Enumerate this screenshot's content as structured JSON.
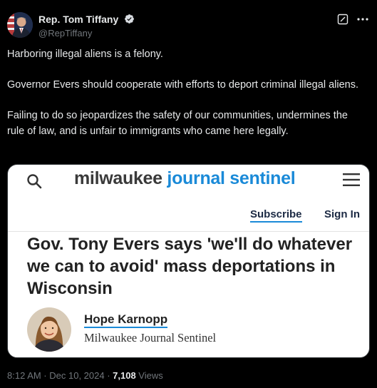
{
  "header": {
    "display_name": "Rep. Tom Tiffany",
    "handle": "@RepTiffany",
    "verified_icon": "verified-badge-icon",
    "grok_icon": "grok-icon",
    "more_icon": "more-icon"
  },
  "tweet": {
    "paragraphs": [
      "Harboring illegal aliens is a felony.",
      "Governor Evers should cooperate with efforts to deport criminal illegal aliens.",
      "Failing to do so jeopardizes the safety of our communities, undermines the rule of law, and is unfair to immigrants who came here legally."
    ]
  },
  "card": {
    "brand_word1": "milwaukee",
    "brand_word2": "journal sentinel",
    "subscribe": "Subscribe",
    "sign_in": "Sign In",
    "headline": "Gov. Tony Evers says 'we'll do whatever we can to avoid' mass deportations in Wisconsin",
    "author_name": "Hope Karnopp",
    "author_org": "Milwaukee Journal Sentinel"
  },
  "meta": {
    "timestamp": "8:12 AM · Dec 10, 2024 · ",
    "views_count": "7,108",
    "views_label": " Views"
  },
  "colors": {
    "background": "#000000",
    "text": "#e7e9ea",
    "muted": "#71767b",
    "brand_blue": "#1a8ad8",
    "verified_blue": "#1d9bf0"
  }
}
